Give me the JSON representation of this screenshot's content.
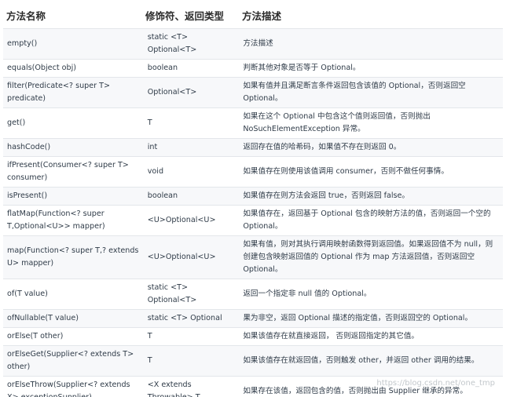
{
  "table": {
    "headers": [
      "方法名称",
      "修饰符、返回类型",
      "方法描述"
    ],
    "rows": [
      {
        "name": "empty()",
        "ret": "static <T> Optional<T>",
        "desc": "方法描述"
      },
      {
        "name": "equals(Object obj)",
        "ret": "boolean",
        "desc": "判断其他对象是否等于 Optional。"
      },
      {
        "name": "filter(Predicate<? super T> predicate)",
        "ret": "Optional<T>",
        "desc": "如果有值并且满足断言条件返回包含该值的 Optional，否则返回空 Optional。"
      },
      {
        "name": "get()",
        "ret": "T",
        "desc": "如果在这个 Optional 中包含这个值则返回值，否则抛出 NoSuchElementException 异常。"
      },
      {
        "name": "hashCode()",
        "ret": "int",
        "desc": "返回存在值的哈希码，如果值不存在则返回 0。"
      },
      {
        "name": "ifPresent(Consumer<? super T> consumer)",
        "ret": "void",
        "desc": "如果值存在则使用该值调用 consumer，否则不做任何事情。"
      },
      {
        "name": "isPresent()",
        "ret": "boolean",
        "desc": "如果值存在则方法会返回 true，否则返回 false。"
      },
      {
        "name": "flatMap(Function<? super T,Optional<U>> mapper)",
        "ret": "<U>Optional<U>",
        "desc": "如果值存在，返回基于 Optional 包含的映射方法的值，否则返回一个空的 Optional。"
      },
      {
        "name": "map(Function<? super T,? extends U> mapper)",
        "ret": "<U>Optional<U>",
        "desc": "如果有值，则对其执行调用映射函数得到返回值。如果返回值不为 null，则创建包含映射返回值的 Optional 作为 map 方法返回值，否则返回空 Optional。"
      },
      {
        "name": "of(T value)",
        "ret": "static <T> Optional<T>",
        "desc": "返回一个指定非 null 值的 Optional。"
      },
      {
        "name": "ofNullable(T value)",
        "ret": "static <T> Optional",
        "desc": "果为非空，返回 Optional 描述的指定值，否则返回空的 Optional。"
      },
      {
        "name": "orElse(T other)",
        "ret": "T",
        "desc": "如果该值存在就直接返回， 否则返回指定的其它值。"
      },
      {
        "name": "orElseGet(Supplier<? extends T> other)",
        "ret": "T",
        "desc": "如果该值存在就返回值，否则触发 other，并返回 other 调用的结果。"
      },
      {
        "name": "orElseThrow(Supplier<? extends X> exceptionSupplier)",
        "ret": "<X extends Throwable> T",
        "desc": "如果存在该值，返回包含的值，否则抛出由 Supplier 继承的异常。"
      }
    ]
  },
  "watermark": "https://blog.csdn.net/one_tmp"
}
